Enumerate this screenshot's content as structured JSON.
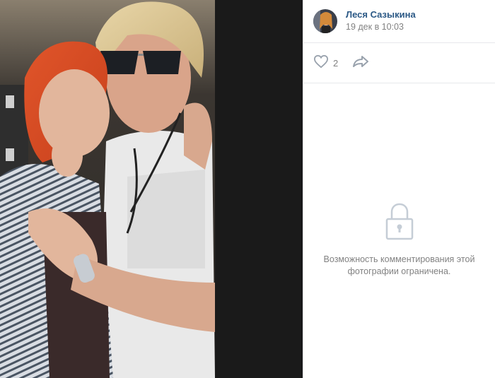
{
  "author": {
    "name": "Леся Сазыкина",
    "date": "19 дек в 10:03"
  },
  "actions": {
    "like_count": "2"
  },
  "comments": {
    "restricted_text": "Возможность комментирования этой фотографии ограничена."
  },
  "colors": {
    "link": "#2a5885",
    "muted": "#828282",
    "divider": "#e7e8ec",
    "icon": "#99a2ad"
  },
  "icons": [
    "heart-icon",
    "share-icon",
    "lock-icon"
  ]
}
